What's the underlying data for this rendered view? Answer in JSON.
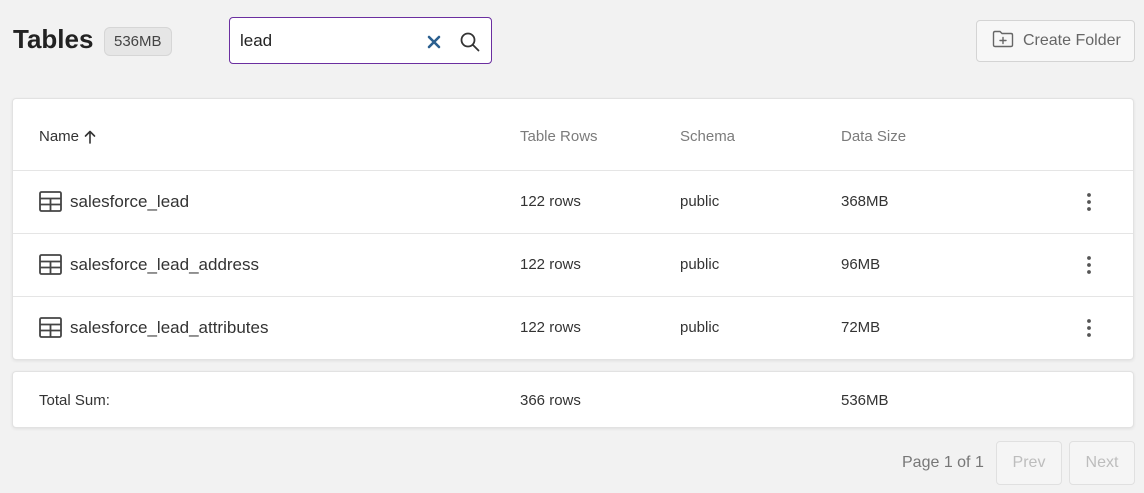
{
  "header": {
    "title": "Tables",
    "size_badge": "536MB",
    "search": {
      "value": "lead",
      "placeholder": ""
    },
    "create_folder_label": "Create Folder"
  },
  "table": {
    "columns": {
      "name": "Name",
      "rows": "Table Rows",
      "schema": "Schema",
      "size": "Data Size"
    },
    "sort": {
      "column": "name",
      "direction": "ascending"
    },
    "rows": [
      {
        "name": "salesforce_lead",
        "rows": "122 rows",
        "schema": "public",
        "size": "368MB"
      },
      {
        "name": "salesforce_lead_address",
        "rows": "122 rows",
        "schema": "public",
        "size": "96MB"
      },
      {
        "name": "salesforce_lead_attributes",
        "rows": "122 rows",
        "schema": "public",
        "size": "72MB"
      }
    ],
    "total": {
      "label": "Total Sum:",
      "rows": "366 rows",
      "size": "536MB"
    }
  },
  "pagination": {
    "label": "Page 1 of 1",
    "prev": "Prev",
    "next": "Next"
  },
  "colors": {
    "accent": "#6b2fa0",
    "clear_icon": "#2b5f8f"
  }
}
